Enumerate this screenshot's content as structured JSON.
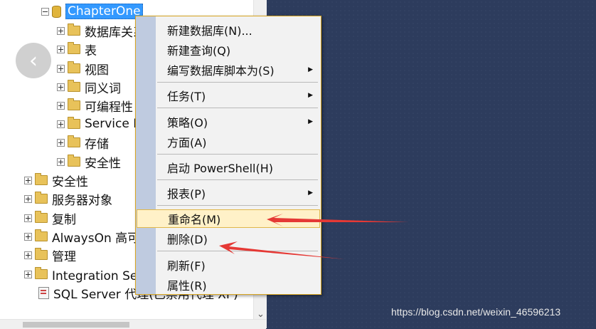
{
  "tree": {
    "root": "ChapterOne",
    "children": [
      "数据库关系图",
      "表",
      "视图",
      "同义词",
      "可编程性",
      "Service Broker",
      "存储",
      "安全性"
    ],
    "server_nodes": [
      "安全性",
      "服务器对象",
      "复制",
      "AlwaysOn 高可用性",
      "管理",
      "Integration Services 目录",
      "SQL Server 代理(已禁用代理 XP)"
    ]
  },
  "back_button": {
    "icon": "chevron-left-icon",
    "glyph": "‹"
  },
  "scrollbar": {
    "down_glyph": "⌄"
  },
  "context_menu": {
    "items": [
      {
        "label": "新建数据库(N)...",
        "submenu": false
      },
      {
        "label": "新建查询(Q)",
        "submenu": false
      },
      {
        "label": "编写数据库脚本为(S)",
        "submenu": true
      },
      {
        "label": "任务(T)",
        "submenu": true
      },
      {
        "label": "策略(O)",
        "submenu": true
      },
      {
        "label": "方面(A)",
        "submenu": false
      },
      {
        "label": "启动 PowerShell(H)",
        "submenu": false
      },
      {
        "label": "报表(P)",
        "submenu": true
      },
      {
        "label": "重命名(M)",
        "submenu": false,
        "highlighted": true
      },
      {
        "label": "删除(D)",
        "submenu": false
      },
      {
        "label": "刷新(F)",
        "submenu": false
      },
      {
        "label": "属性(R)",
        "submenu": false
      }
    ],
    "submenu_glyph": "▶"
  },
  "annotations": {
    "arrow_color": "#e53935"
  },
  "watermark": "https://blog.csdn.net/weixin_46596213"
}
